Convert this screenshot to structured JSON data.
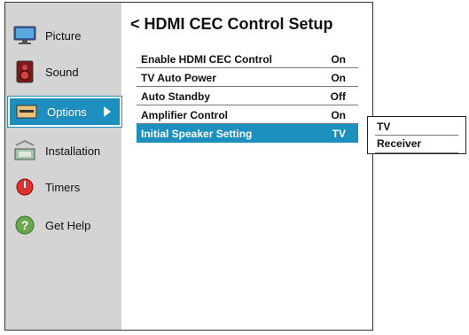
{
  "sidebar": {
    "items": [
      {
        "label": "Picture",
        "icon": "tv-icon",
        "active": false
      },
      {
        "label": "Sound",
        "icon": "speaker-icon",
        "active": false
      },
      {
        "label": "Options",
        "icon": "options-icon",
        "active": true
      },
      {
        "label": "Installation",
        "icon": "installation-icon",
        "active": false
      },
      {
        "label": "Timers",
        "icon": "timer-icon",
        "active": false
      },
      {
        "label": "Get Help",
        "icon": "help-icon",
        "active": false
      }
    ]
  },
  "main": {
    "back_glyph": "<",
    "title": "HDMI CEC Control Setup",
    "rows": [
      {
        "label": "Enable HDMI CEC Control",
        "value": "On"
      },
      {
        "label": "TV Auto Power",
        "value": "On"
      },
      {
        "label": "Auto Standby",
        "value": "Off"
      },
      {
        "label": "Amplifier Control",
        "value": "On"
      },
      {
        "label": "Initial Speaker Setting",
        "value": "TV",
        "selected": true
      }
    ]
  },
  "popup": {
    "options": [
      "TV",
      "Receiver"
    ]
  },
  "colors": {
    "accent": "#1d8fbf",
    "sidebar_bg": "#d4d4d4"
  }
}
